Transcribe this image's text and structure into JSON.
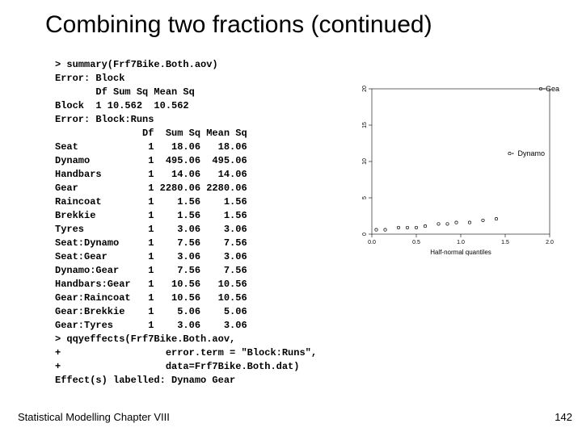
{
  "title": "Combining two fractions (continued)",
  "code": "> summary(Frf7Bike.Both.aov)\nError: Block\n       Df Sum Sq Mean Sq\nBlock  1 10.562  10.562\nError: Block:Runs\n               Df  Sum Sq Mean Sq\nSeat            1   18.06   18.06\nDynamo          1  495.06  495.06\nHandbars        1   14.06   14.06\nGear            1 2280.06 2280.06\nRaincoat        1    1.56    1.56\nBrekkie         1    1.56    1.56\nTyres           1    3.06    3.06\nSeat:Dynamo     1    7.56    7.56\nSeat:Gear       1    3.06    3.06\nDynamo:Gear     1    7.56    7.56\nHandbars:Gear   1   10.56   10.56\nGear:Raincoat   1   10.56   10.56\nGear:Brekkie    1    5.06    5.06\nGear:Tyres      1    3.06    3.06\n> qqyeffects(Frf7Bike.Both.aov,\n+                  error.term = \"Block:Runs\",\n+                  data=Frf7Bike.Both.dat)\nEffect(s) labelled: Dynamo Gear",
  "footer_left": "Statistical Modelling   Chapter VIII",
  "footer_right": "142",
  "chart_data": {
    "type": "scatter",
    "xlabel": "Half-normal quantiles",
    "ylabel": "",
    "xlim": [
      0.0,
      2.0
    ],
    "ylim": [
      0,
      20
    ],
    "x_ticks": [
      0.0,
      0.5,
      1.0,
      1.5,
      2.0
    ],
    "y_ticks": [
      0,
      5,
      10,
      15,
      20
    ],
    "points": [
      {
        "x": 0.05,
        "y": 0.6
      },
      {
        "x": 0.15,
        "y": 0.6
      },
      {
        "x": 0.3,
        "y": 0.9
      },
      {
        "x": 0.4,
        "y": 0.9
      },
      {
        "x": 0.5,
        "y": 0.9
      },
      {
        "x": 0.6,
        "y": 1.1
      },
      {
        "x": 0.75,
        "y": 1.4
      },
      {
        "x": 0.85,
        "y": 1.4
      },
      {
        "x": 0.95,
        "y": 1.6
      },
      {
        "x": 1.1,
        "y": 1.6
      },
      {
        "x": 1.25,
        "y": 1.9
      },
      {
        "x": 1.4,
        "y": 2.1
      },
      {
        "x": 1.55,
        "y": 11.1,
        "label": "Dynamo"
      },
      {
        "x": 1.9,
        "y": 20.0,
        "label": "Gear"
      }
    ]
  }
}
